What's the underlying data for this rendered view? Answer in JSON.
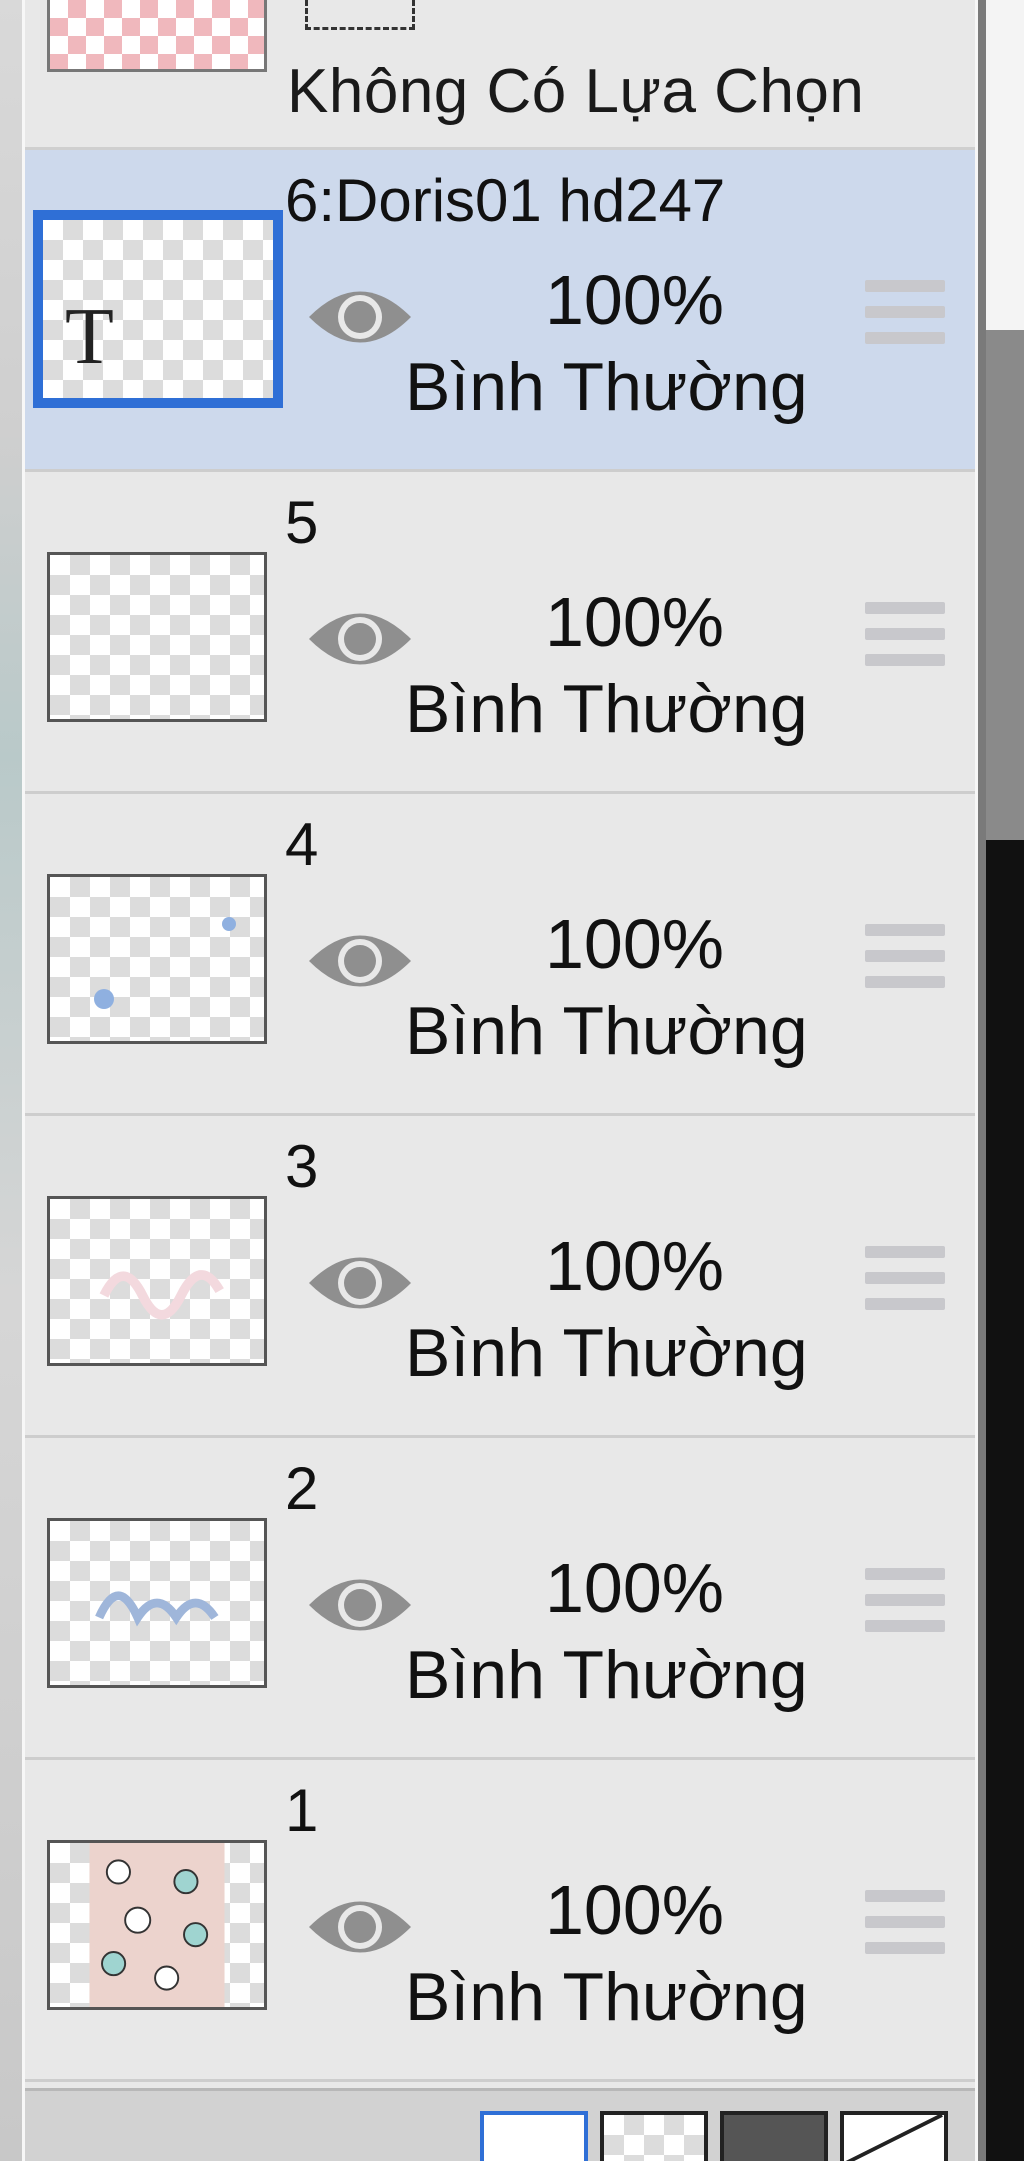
{
  "selection": {
    "label": "Không Có Lựa Chọn"
  },
  "layers": [
    {
      "name": "6:Doris01 hd247",
      "opacity": "100%",
      "blend": "Bình Thường",
      "active": true,
      "thumb_icon": "T"
    },
    {
      "name": "5",
      "opacity": "100%",
      "blend": "Bình Thường",
      "active": false
    },
    {
      "name": "4",
      "opacity": "100%",
      "blend": "Bình Thường",
      "active": false
    },
    {
      "name": "3",
      "opacity": "100%",
      "blend": "Bình Thường",
      "active": false
    },
    {
      "name": "2",
      "opacity": "100%",
      "blend": "Bình Thường",
      "active": false
    },
    {
      "name": "1",
      "opacity": "100%",
      "blend": "Bình Thường",
      "active": false
    }
  ],
  "colors": {
    "accent": "#2f6fd6",
    "active_row": "#cdd9ec",
    "panel": "#e8e8e8",
    "eye": "#8f8f8f"
  },
  "icons": {
    "visibility": "eye-icon",
    "reorder": "drag-handle-icon"
  }
}
